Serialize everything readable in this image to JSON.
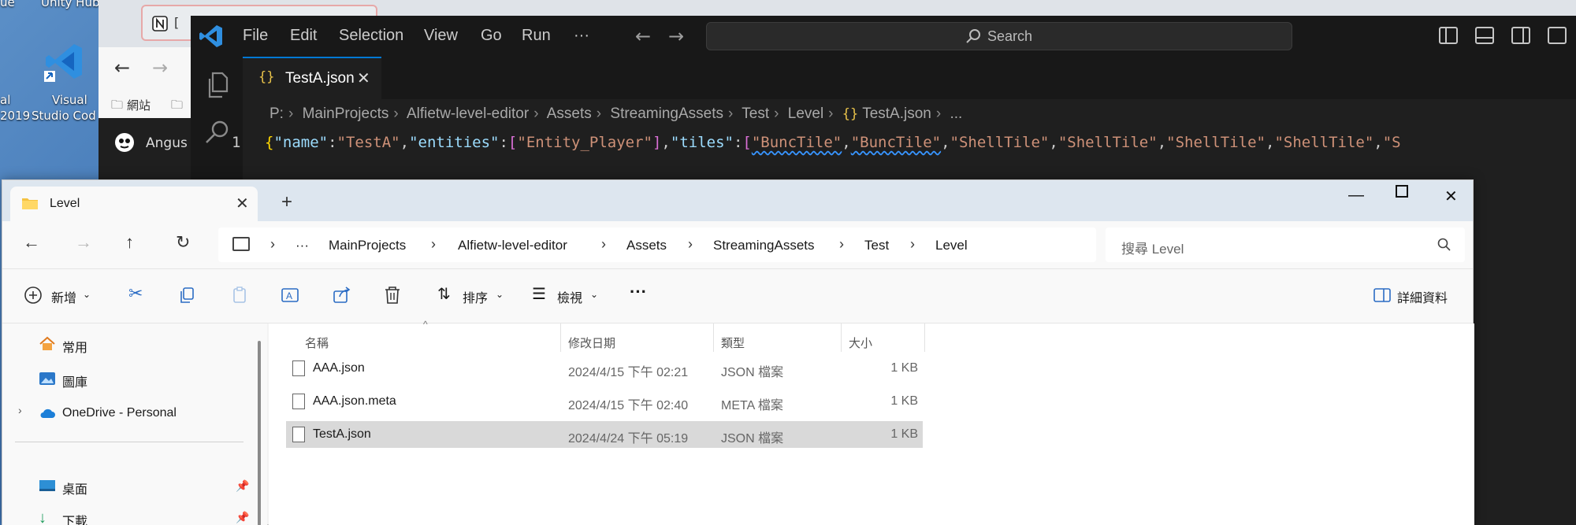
{
  "desktop": {
    "icon_labels": [
      "Unity Hub",
      "Visual Studio Code"
    ],
    "fragments": [
      "ue",
      "2019",
      "al",
      "Studio Cod"
    ]
  },
  "browser": {
    "tab_title": "[",
    "bookmark": "網站",
    "profile_name": "Angus"
  },
  "vscode": {
    "menu": [
      "File",
      "Edit",
      "Selection",
      "View",
      "Go",
      "Run",
      "···"
    ],
    "search_placeholder": "Search",
    "tab": {
      "icon": "{}",
      "label": "TestA.json",
      "close": "✕"
    },
    "breadcrumb": [
      "P:",
      "MainProjects",
      "Alfietw-level-editor",
      "Assets",
      "StreamingAssets",
      "Test",
      "Level",
      "TestA.json",
      "..."
    ],
    "line_number": "1",
    "code_tokens": [
      {
        "t": "{",
        "c": "tk-brace"
      },
      {
        "t": "\"name\"",
        "c": "tk-key"
      },
      {
        "t": ":",
        "c": "tk-punc"
      },
      {
        "t": "\"TestA\"",
        "c": "tk-str"
      },
      {
        "t": ",",
        "c": "tk-punc"
      },
      {
        "t": "\"entities\"",
        "c": "tk-key"
      },
      {
        "t": ":",
        "c": "tk-punc"
      },
      {
        "t": "[",
        "c": "tk-bracket"
      },
      {
        "t": "\"Entity_Player\"",
        "c": "tk-str"
      },
      {
        "t": "]",
        "c": "tk-bracket"
      },
      {
        "t": ",",
        "c": "tk-punc"
      },
      {
        "t": "\"tiles\"",
        "c": "tk-key"
      },
      {
        "t": ":",
        "c": "tk-punc"
      },
      {
        "t": "[",
        "c": "tk-bracket"
      },
      {
        "t": "\"BuncTile\"",
        "c": "tk-str tk-squig"
      },
      {
        "t": ",",
        "c": "tk-punc"
      },
      {
        "t": "\"BuncTile\"",
        "c": "tk-str tk-squig"
      },
      {
        "t": ",",
        "c": "tk-punc"
      },
      {
        "t": "\"ShellTile\"",
        "c": "tk-str"
      },
      {
        "t": ",",
        "c": "tk-punc"
      },
      {
        "t": "\"ShellTile\"",
        "c": "tk-str"
      },
      {
        "t": ",",
        "c": "tk-punc"
      },
      {
        "t": "\"ShellTile\"",
        "c": "tk-str"
      },
      {
        "t": ",",
        "c": "tk-punc"
      },
      {
        "t": "\"ShellTile\"",
        "c": "tk-str"
      },
      {
        "t": ",",
        "c": "tk-punc"
      },
      {
        "t": "\"S",
        "c": "tk-str"
      }
    ]
  },
  "explorer": {
    "tab_label": "Level",
    "address": [
      "MainProjects",
      "Alfietw-level-editor",
      "Assets",
      "StreamingAssets",
      "Test",
      "Level"
    ],
    "address_overflow": "···",
    "search_placeholder": "搜尋 Level",
    "toolbar": {
      "new_label": "新增",
      "sort_label": "排序",
      "view_label": "檢視",
      "more_label": "···",
      "details_label": "詳細資料"
    },
    "sidebar": [
      {
        "label": "常用",
        "icon": "home-icon"
      },
      {
        "label": "圖庫",
        "icon": "gallery-icon"
      },
      {
        "label": "OneDrive - Personal",
        "icon": "cloud-icon"
      },
      {
        "label": "桌面",
        "icon": "desktop-icon"
      },
      {
        "label": "下載",
        "icon": "download-icon"
      }
    ],
    "columns": [
      "名稱",
      "修改日期",
      "類型",
      "大小"
    ],
    "files": [
      {
        "name": "AAA.json",
        "date": "2024/4/15 下午 02:21",
        "type": "JSON 檔案",
        "size": "1 KB"
      },
      {
        "name": "AAA.json.meta",
        "date": "2024/4/15 下午 02:40",
        "type": "META 檔案",
        "size": "1 KB"
      },
      {
        "name": "TestA.json",
        "date": "2024/4/24 下午 05:19",
        "type": "JSON 檔案",
        "size": "1 KB"
      }
    ]
  }
}
